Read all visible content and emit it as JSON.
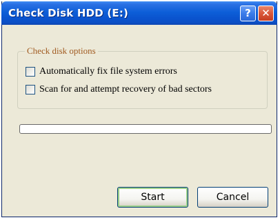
{
  "window": {
    "title": "Check Disk HDD (E:)",
    "help_icon": "?",
    "close_icon": "✕"
  },
  "options": {
    "group_label": "Check disk options",
    "fix_errors_label": "Automatically fix file system errors",
    "fix_errors_checked": false,
    "scan_sectors_label": "Scan for and attempt recovery of bad sectors",
    "scan_sectors_checked": false
  },
  "progress": {
    "fraction": 0
  },
  "buttons": {
    "start_label": "Start",
    "cancel_label": "Cancel"
  },
  "colors": {
    "titlebar": "#0a54cf",
    "dialog_background": "#ece9d8",
    "group_label": "#a05a20",
    "close_button": "#d9573a"
  }
}
